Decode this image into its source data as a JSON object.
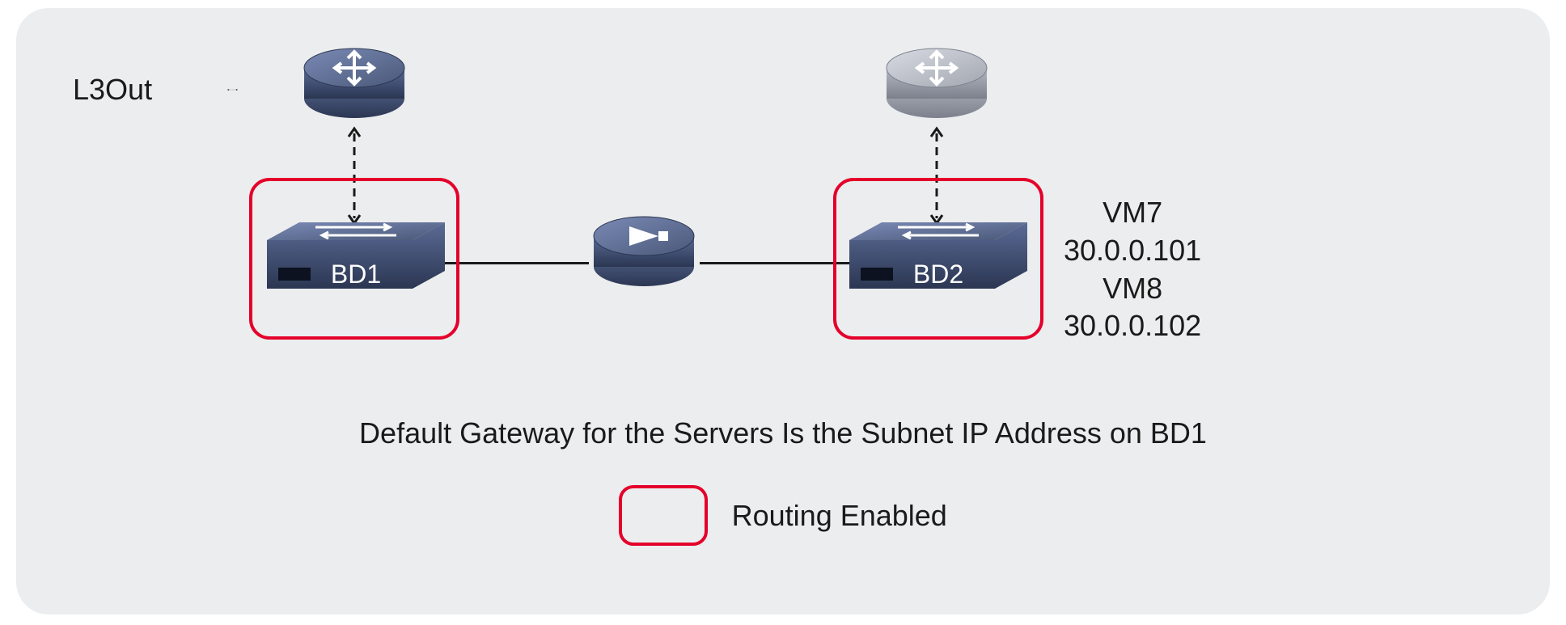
{
  "labels": {
    "l3out": "L3Out",
    "bd1": "BD1",
    "bd2": "BD2",
    "caption": "Default Gateway for the Servers Is the Subnet IP Address on BD1",
    "legend": "Routing Enabled"
  },
  "vms": {
    "vm7_name": "VM7",
    "vm7_ip": "30.0.0.101",
    "vm8_name": "VM8",
    "vm8_ip": "30.0.0.102"
  },
  "colors": {
    "accent_red": "#e4002b",
    "device_dark": "#3c4866",
    "device_grey": "#8f9299",
    "bg": "#ecedee"
  }
}
